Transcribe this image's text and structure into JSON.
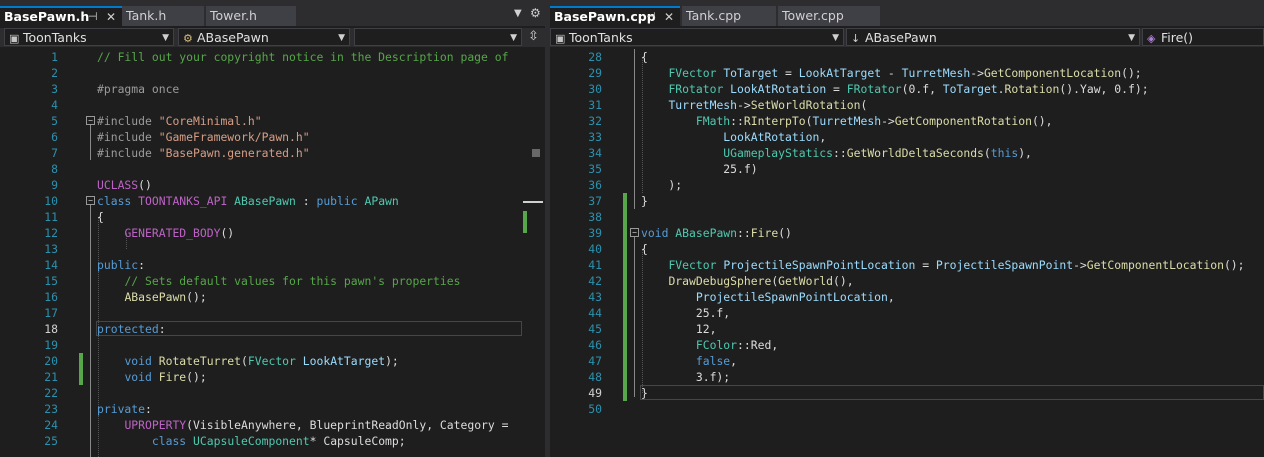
{
  "left": {
    "tabs": [
      {
        "label": "BasePawn.h",
        "active": true
      },
      {
        "label": "Tank.h",
        "active": false
      },
      {
        "label": "Tower.h",
        "active": false
      }
    ],
    "nav": {
      "project": "ToonTanks",
      "scope": "ABasePawn",
      "member": ""
    },
    "current_line": "18",
    "lines": [
      {
        "n": "1",
        "t": [
          [
            "c-com",
            "// Fill out your copyright notice in the Description page of"
          ]
        ]
      },
      {
        "n": "2",
        "t": []
      },
      {
        "n": "3",
        "t": [
          [
            "c-pp",
            "#pragma once"
          ]
        ]
      },
      {
        "n": "4",
        "t": []
      },
      {
        "n": "5",
        "t": [
          [
            "c-pp",
            "#include "
          ],
          [
            "c-str",
            "\"CoreMinimal.h\""
          ]
        ]
      },
      {
        "n": "6",
        "t": [
          [
            "c-pp",
            "#include "
          ],
          [
            "c-str",
            "\"GameFramework/Pawn.h\""
          ]
        ]
      },
      {
        "n": "7",
        "t": [
          [
            "c-pp",
            "#include "
          ],
          [
            "c-str",
            "\"BasePawn.generated.h\""
          ]
        ]
      },
      {
        "n": "8",
        "t": []
      },
      {
        "n": "9",
        "t": [
          [
            "c-mac",
            "UCLASS"
          ],
          [
            "c-tx",
            "()"
          ]
        ]
      },
      {
        "n": "10",
        "t": [
          [
            "c-kw",
            "class "
          ],
          [
            "c-mac",
            "TOONTANKS_API "
          ],
          [
            "c-type",
            "ABasePawn "
          ],
          [
            "c-tx",
            ": "
          ],
          [
            "c-kw",
            "public "
          ],
          [
            "c-type",
            "APawn"
          ]
        ]
      },
      {
        "n": "11",
        "t": [
          [
            "c-tx",
            "{"
          ]
        ]
      },
      {
        "n": "12",
        "t": [
          [
            "c-tx",
            "    "
          ],
          [
            "c-mac",
            "GENERATED_BODY"
          ],
          [
            "c-tx",
            "()"
          ]
        ]
      },
      {
        "n": "13",
        "t": []
      },
      {
        "n": "14",
        "t": [
          [
            "c-kw",
            "public"
          ],
          [
            "c-tx",
            ":"
          ]
        ]
      },
      {
        "n": "15",
        "t": [
          [
            "c-tx",
            "    "
          ],
          [
            "c-com",
            "// Sets default values for this pawn's properties"
          ]
        ]
      },
      {
        "n": "16",
        "t": [
          [
            "c-tx",
            "    "
          ],
          [
            "c-fn",
            "ABasePawn"
          ],
          [
            "c-tx",
            "();"
          ]
        ]
      },
      {
        "n": "17",
        "t": []
      },
      {
        "n": "18",
        "t": [
          [
            "c-kw",
            "protected"
          ],
          [
            "c-tx",
            ":"
          ]
        ]
      },
      {
        "n": "19",
        "t": []
      },
      {
        "n": "20",
        "t": [
          [
            "c-tx",
            "    "
          ],
          [
            "c-kw",
            "void "
          ],
          [
            "c-fn",
            "RotateTurret"
          ],
          [
            "c-tx",
            "("
          ],
          [
            "c-type",
            "FVector "
          ],
          [
            "c-var",
            "LookAtTarget"
          ],
          [
            "c-tx",
            ");"
          ]
        ]
      },
      {
        "n": "21",
        "t": [
          [
            "c-tx",
            "    "
          ],
          [
            "c-kw",
            "void "
          ],
          [
            "c-fn",
            "Fire"
          ],
          [
            "c-tx",
            "();"
          ]
        ]
      },
      {
        "n": "22",
        "t": []
      },
      {
        "n": "23",
        "t": [
          [
            "c-kw",
            "private"
          ],
          [
            "c-tx",
            ":"
          ]
        ]
      },
      {
        "n": "24",
        "t": [
          [
            "c-tx",
            "    "
          ],
          [
            "c-mac",
            "UPROPERTY"
          ],
          [
            "c-tx",
            "(VisibleAnywhere, BlueprintReadOnly, Category ="
          ]
        ]
      },
      {
        "n": "25",
        "t": [
          [
            "c-tx",
            "        "
          ],
          [
            "c-kw",
            "class "
          ],
          [
            "c-type",
            "UCapsuleComponent"
          ],
          [
            "c-tx",
            "* CapsuleComp;"
          ]
        ]
      }
    ]
  },
  "right": {
    "tabs": [
      {
        "label": "BasePawn.cpp",
        "active": true
      },
      {
        "label": "Tank.cpp",
        "active": false
      },
      {
        "label": "Tower.cpp",
        "active": false
      }
    ],
    "nav": {
      "project": "ToonTanks",
      "scope": "ABasePawn",
      "member": "Fire()"
    },
    "current_line": "49",
    "lines": [
      {
        "n": "28",
        "t": [
          [
            "c-tx",
            "{"
          ]
        ]
      },
      {
        "n": "29",
        "t": [
          [
            "c-tx",
            "    "
          ],
          [
            "c-type",
            "FVector "
          ],
          [
            "c-var",
            "ToTarget"
          ],
          [
            "c-tx",
            " = "
          ],
          [
            "c-var",
            "LookAtTarget"
          ],
          [
            "c-tx",
            " - "
          ],
          [
            "c-var",
            "TurretMesh"
          ],
          [
            "c-tx",
            "->"
          ],
          [
            "c-fn",
            "GetComponentLocation"
          ],
          [
            "c-tx",
            "();"
          ]
        ]
      },
      {
        "n": "30",
        "t": [
          [
            "c-tx",
            "    "
          ],
          [
            "c-type",
            "FRotator "
          ],
          [
            "c-var",
            "LookAtRotation"
          ],
          [
            "c-tx",
            " = "
          ],
          [
            "c-type",
            "FRotator"
          ],
          [
            "c-tx",
            "(0.f, "
          ],
          [
            "c-var",
            "ToTarget"
          ],
          [
            "c-tx",
            "."
          ],
          [
            "c-fn",
            "Rotation"
          ],
          [
            "c-tx",
            "().Yaw, 0.f);"
          ]
        ]
      },
      {
        "n": "31",
        "t": [
          [
            "c-tx",
            "    "
          ],
          [
            "c-var",
            "TurretMesh"
          ],
          [
            "c-tx",
            "->"
          ],
          [
            "c-fn",
            "SetWorldRotation"
          ],
          [
            "c-tx",
            "("
          ]
        ]
      },
      {
        "n": "32",
        "t": [
          [
            "c-tx",
            "        "
          ],
          [
            "c-type",
            "FMath"
          ],
          [
            "c-tx",
            "::"
          ],
          [
            "c-fn",
            "RInterpTo"
          ],
          [
            "c-tx",
            "("
          ],
          [
            "c-var",
            "TurretMesh"
          ],
          [
            "c-tx",
            "->"
          ],
          [
            "c-fn",
            "GetComponentRotation"
          ],
          [
            "c-tx",
            "(),"
          ]
        ]
      },
      {
        "n": "33",
        "t": [
          [
            "c-tx",
            "            "
          ],
          [
            "c-var",
            "LookAtRotation"
          ],
          [
            "c-tx",
            ","
          ]
        ]
      },
      {
        "n": "34",
        "t": [
          [
            "c-tx",
            "            "
          ],
          [
            "c-type",
            "UGameplayStatics"
          ],
          [
            "c-tx",
            "::"
          ],
          [
            "c-fn",
            "GetWorldDeltaSeconds"
          ],
          [
            "c-tx",
            "("
          ],
          [
            "c-kw",
            "this"
          ],
          [
            "c-tx",
            "),"
          ]
        ]
      },
      {
        "n": "35",
        "t": [
          [
            "c-tx",
            "            25.f)"
          ]
        ]
      },
      {
        "n": "36",
        "t": [
          [
            "c-tx",
            "    );"
          ]
        ]
      },
      {
        "n": "37",
        "t": [
          [
            "c-tx",
            "}"
          ]
        ]
      },
      {
        "n": "38",
        "t": []
      },
      {
        "n": "39",
        "t": [
          [
            "c-kw",
            "void "
          ],
          [
            "c-type",
            "ABasePawn"
          ],
          [
            "c-tx",
            "::"
          ],
          [
            "c-fn",
            "Fire"
          ],
          [
            "c-tx",
            "()"
          ]
        ]
      },
      {
        "n": "40",
        "t": [
          [
            "c-tx",
            "{"
          ]
        ]
      },
      {
        "n": "41",
        "t": [
          [
            "c-tx",
            "    "
          ],
          [
            "c-type",
            "FVector "
          ],
          [
            "c-var",
            "ProjectileSpawnPointLocation"
          ],
          [
            "c-tx",
            " = "
          ],
          [
            "c-var",
            "ProjectileSpawnPoint"
          ],
          [
            "c-tx",
            "->"
          ],
          [
            "c-fn",
            "GetComponentLocation"
          ],
          [
            "c-tx",
            "();"
          ]
        ]
      },
      {
        "n": "42",
        "t": [
          [
            "c-tx",
            "    "
          ],
          [
            "c-fn",
            "DrawDebugSphere"
          ],
          [
            "c-tx",
            "("
          ],
          [
            "c-fn",
            "GetWorld"
          ],
          [
            "c-tx",
            "(),"
          ]
        ]
      },
      {
        "n": "43",
        "t": [
          [
            "c-tx",
            "        "
          ],
          [
            "c-var",
            "ProjectileSpawnPointLocation"
          ],
          [
            "c-tx",
            ","
          ]
        ]
      },
      {
        "n": "44",
        "t": [
          [
            "c-tx",
            "        25.f,"
          ]
        ]
      },
      {
        "n": "45",
        "t": [
          [
            "c-tx",
            "        12,"
          ]
        ]
      },
      {
        "n": "46",
        "t": [
          [
            "c-tx",
            "        "
          ],
          [
            "c-type",
            "FColor"
          ],
          [
            "c-tx",
            "::Red,"
          ]
        ]
      },
      {
        "n": "47",
        "t": [
          [
            "c-tx",
            "        "
          ],
          [
            "c-kw",
            "false"
          ],
          [
            "c-tx",
            ","
          ]
        ]
      },
      {
        "n": "48",
        "t": [
          [
            "c-tx",
            "        3.f);"
          ]
        ]
      },
      {
        "n": "49",
        "t": [
          [
            "c-tx",
            "}"
          ]
        ]
      },
      {
        "n": "50",
        "t": []
      }
    ]
  },
  "icons": {
    "pin": "pin-icon",
    "close": "close-icon",
    "dropdown": "chevron-down-icon",
    "gear": "gear-icon",
    "split": "split-icon",
    "class": "class-icon",
    "arrow": "down-arrow-icon",
    "method": "method-icon"
  },
  "colors": {
    "accent": "#007acc",
    "change": "#57a64a",
    "background": "#1e1e1e"
  }
}
